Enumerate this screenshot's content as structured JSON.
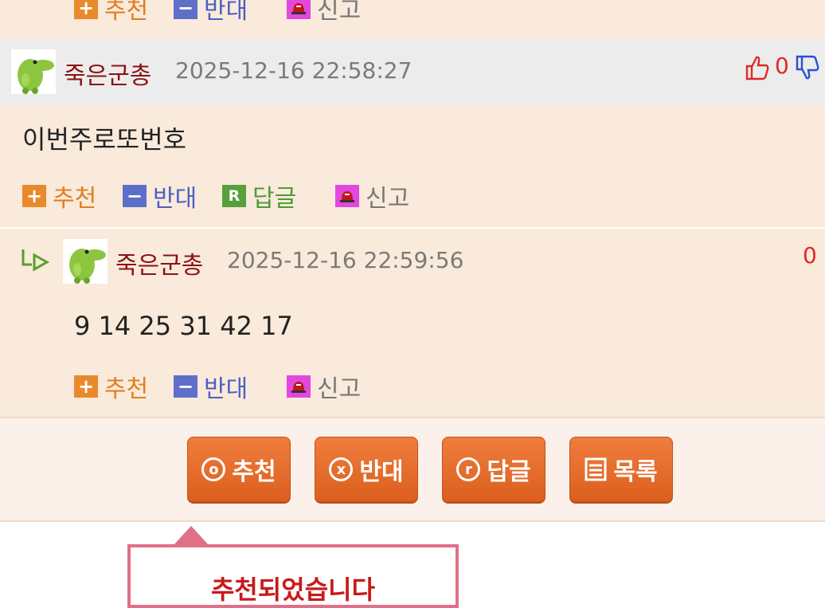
{
  "top_actions": {
    "recommend": "추천",
    "oppose": "반대",
    "report": "신고"
  },
  "comment": {
    "nickname": "죽은군총",
    "timestamp": "2025-12-16 22:58:27",
    "like_count": "0",
    "text": "이번주로또번호",
    "actions": {
      "recommend": "추천",
      "oppose": "반대",
      "reply": "답글",
      "report": "신고"
    }
  },
  "reply": {
    "nickname": "죽은군총",
    "timestamp": "2025-12-16 22:59:56",
    "count": "0",
    "text": "9 14 25 31 42 17",
    "actions": {
      "recommend": "추천",
      "oppose": "반대",
      "report": "신고"
    }
  },
  "bottom_buttons": {
    "recommend": {
      "icon": "o",
      "label": "추천"
    },
    "oppose": {
      "icon": "x",
      "label": "반대"
    },
    "reply": {
      "icon": "r",
      "label": "답글"
    },
    "list": {
      "label": "목록"
    }
  },
  "tooltip": {
    "text": "추천되었습니다"
  },
  "colors": {
    "accent": "#e0652a",
    "nickname": "#8b1212",
    "peach": "#f9eadb"
  }
}
